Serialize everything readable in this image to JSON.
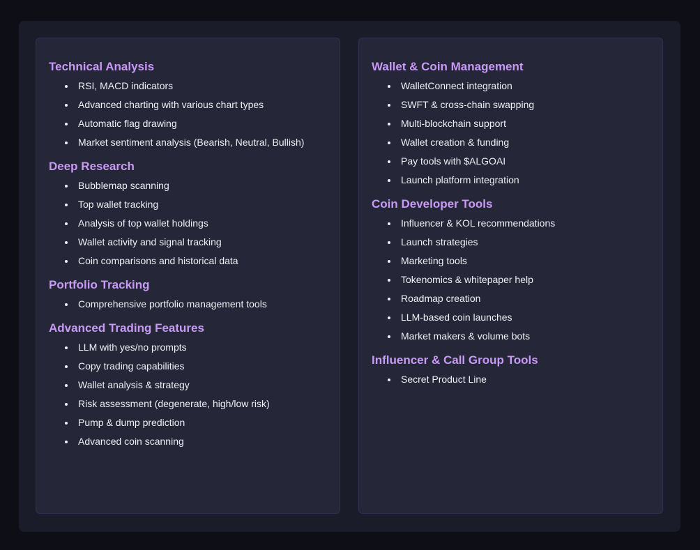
{
  "left_column": {
    "sections": [
      {
        "title": "Technical Analysis",
        "items": [
          "RSI, MACD indicators",
          "Advanced charting with various chart types",
          "Automatic flag drawing",
          "Market sentiment analysis (Bearish, Neutral, Bullish)"
        ]
      },
      {
        "title": "Deep Research",
        "items": [
          "Bubblemap scanning",
          "Top wallet tracking",
          "Analysis of top wallet holdings",
          "Wallet activity and signal tracking",
          "Coin comparisons and historical data"
        ]
      },
      {
        "title": "Portfolio Tracking",
        "items": [
          "Comprehensive portfolio management tools"
        ]
      },
      {
        "title": "Advanced Trading Features",
        "items": [
          "LLM with yes/no prompts",
          "Copy trading capabilities",
          "Wallet analysis & strategy",
          "Risk assessment (degenerate, high/low risk)",
          "Pump & dump prediction",
          "Advanced coin scanning"
        ]
      }
    ]
  },
  "right_column": {
    "sections": [
      {
        "title": "Wallet & Coin Management",
        "items": [
          "WalletConnect integration",
          "SWFT & cross-chain swapping",
          "Multi-blockchain support",
          "Wallet creation & funding",
          "Pay tools with $ALGOAI",
          "Launch platform integration"
        ]
      },
      {
        "title": "Coin Developer Tools",
        "items": [
          "Influencer & KOL recommendations",
          "Launch strategies",
          "Marketing tools",
          "Tokenomics & whitepaper help",
          "Roadmap creation",
          "LLM-based coin launches",
          "Market makers & volume bots"
        ]
      },
      {
        "title": "Influencer & Call Group Tools",
        "items": [
          "Secret Product Line"
        ]
      }
    ]
  }
}
